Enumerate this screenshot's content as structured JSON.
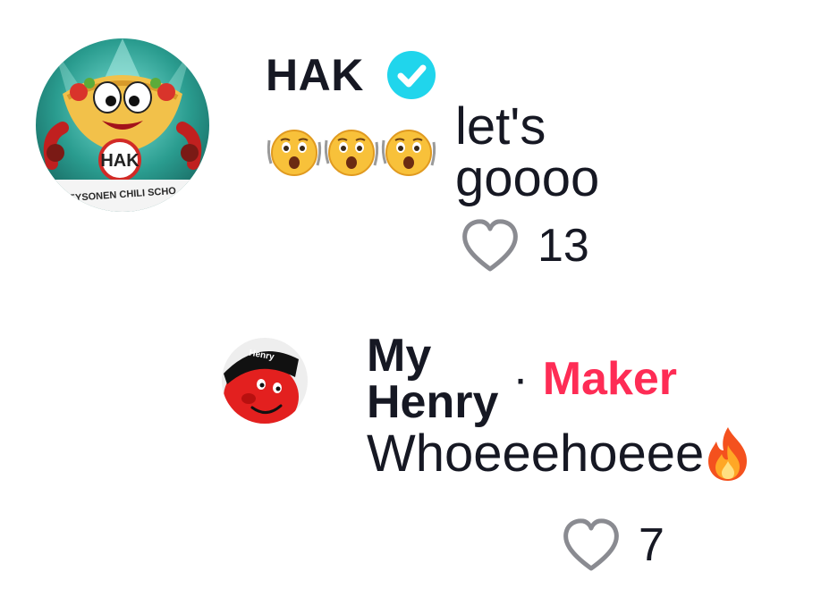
{
  "colors": {
    "verified_badge": "#20d5ec",
    "maker_label": "#fe2c55",
    "heart_outline": "#8a8b91",
    "text": "#161823"
  },
  "comments": [
    {
      "username": "HAK",
      "verified": true,
      "avatar_text": "HAK",
      "avatar_banner": "EYSONEN CHILI SCHO",
      "emojis": [
        "hushed-face-emoji",
        "hushed-face-emoji",
        "hushed-face-emoji"
      ],
      "text": "let's goooo",
      "likes": "13",
      "like_icon": "heart-outline-icon"
    },
    {
      "username": "My Henry",
      "separator": "·",
      "role_label": "Maker",
      "avatar_text": "Henry",
      "text": "Whoeeehoeee",
      "trailing_emoji": "fire-emoji",
      "likes": "7",
      "like_icon": "heart-outline-icon"
    }
  ]
}
